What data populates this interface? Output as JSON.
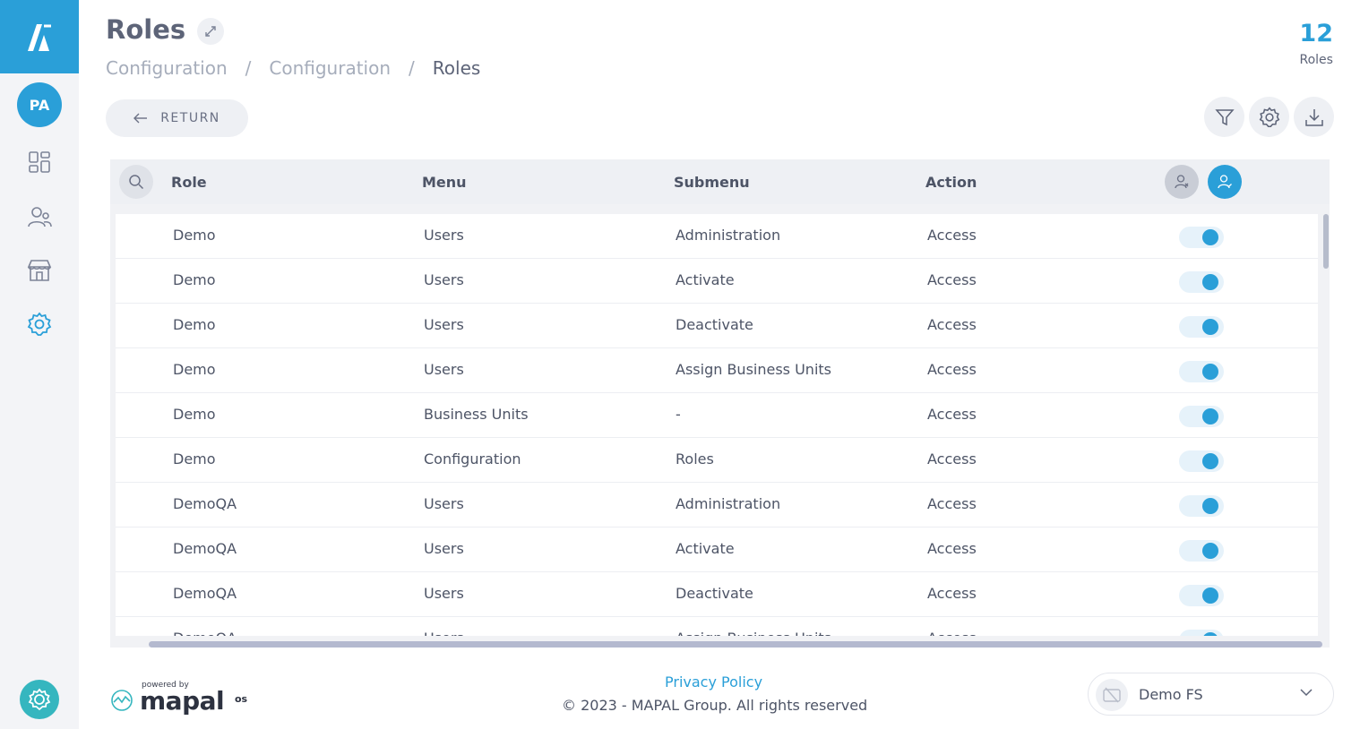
{
  "sidebar": {
    "user_initials": "PA",
    "icons": [
      "dashboard-icon",
      "users-icon",
      "store-icon",
      "settings-icon"
    ],
    "help_icon": "support-icon"
  },
  "header": {
    "title": "Roles",
    "breadcrumb": [
      "Configuration",
      "Configuration",
      "Roles"
    ],
    "separator": "/",
    "count": "12",
    "count_label": "Roles"
  },
  "toolbar": {
    "return_label": "RETURN"
  },
  "table": {
    "columns": [
      "Role",
      "Menu",
      "Submenu",
      "Action"
    ],
    "rows": [
      {
        "role": "Demo",
        "menu": "Users",
        "submenu": "Administration",
        "action": "Access",
        "enabled": true
      },
      {
        "role": "Demo",
        "menu": "Users",
        "submenu": "Activate",
        "action": "Access",
        "enabled": true
      },
      {
        "role": "Demo",
        "menu": "Users",
        "submenu": "Deactivate",
        "action": "Access",
        "enabled": true
      },
      {
        "role": "Demo",
        "menu": "Users",
        "submenu": "Assign Business Units",
        "action": "Access",
        "enabled": true
      },
      {
        "role": "Demo",
        "menu": "Business Units",
        "submenu": "-",
        "action": "Access",
        "enabled": true
      },
      {
        "role": "Demo",
        "menu": "Configuration",
        "submenu": "Roles",
        "action": "Access",
        "enabled": true
      },
      {
        "role": "DemoQA",
        "menu": "Users",
        "submenu": "Administration",
        "action": "Access",
        "enabled": true
      },
      {
        "role": "DemoQA",
        "menu": "Users",
        "submenu": "Activate",
        "action": "Access",
        "enabled": true
      },
      {
        "role": "DemoQA",
        "menu": "Users",
        "submenu": "Deactivate",
        "action": "Access",
        "enabled": true
      },
      {
        "role": "DemoQA",
        "menu": "Users",
        "submenu": "Assign Business Units",
        "action": "Access",
        "enabled": true
      }
    ]
  },
  "footer": {
    "powered_by": "powered by",
    "brand": "mapal",
    "brand_suffix": "os",
    "privacy": "Privacy Policy",
    "copyright": "© 2023 - MAPAL Group. All rights reserved",
    "company": "Demo FS"
  },
  "colors": {
    "accent": "#2a9fd8",
    "help": "#35b6bf"
  }
}
